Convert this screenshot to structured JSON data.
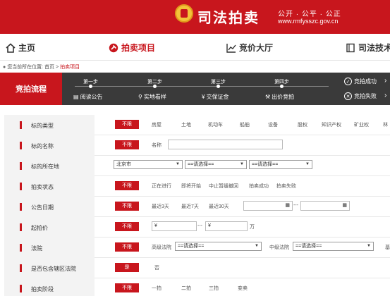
{
  "header": {
    "brand": "司法拍卖",
    "slogan": "公开 · 公平 · 公正",
    "domain": "www.rmfysszc.gov.cn"
  },
  "nav": {
    "items": [
      {
        "label": "主页",
        "icon": "home-icon"
      },
      {
        "label": "拍卖项目",
        "icon": "gavel-icon"
      },
      {
        "label": "竞价大厅",
        "icon": "chart-icon"
      },
      {
        "label": "司法技术",
        "icon": "book-icon"
      }
    ]
  },
  "breadcrumb": {
    "prefix": "您当前所在位置:",
    "home": "首页",
    "sep": ">",
    "current": "拍卖项目"
  },
  "flow": {
    "title": "竞拍流程",
    "steps": [
      {
        "num": "第一步",
        "label": "阅读公告"
      },
      {
        "num": "第二步",
        "label": "实地看样"
      },
      {
        "num": "第三步",
        "label": "交保证金"
      },
      {
        "num": "第四步",
        "label": "出价竞拍"
      }
    ],
    "success": "竞拍成功",
    "fail": "竞拍失败"
  },
  "filters": {
    "unlimited": "不限",
    "type": {
      "label": "标的类型",
      "options": [
        "房屋",
        "土地",
        "机动车",
        "船舶",
        "设备",
        "股权",
        "知识产权",
        "矿业权",
        "林"
      ]
    },
    "name": {
      "label": "标的名称",
      "field_label": "名称",
      "value": ""
    },
    "location": {
      "label": "标的所在地",
      "city": "北京市",
      "district": "==请选择==",
      "area": "==请选择=="
    },
    "status": {
      "label": "拍卖状态",
      "options": [
        "正在进行",
        "即将开始",
        "中止暂缓撤回",
        "拍卖成功",
        "拍卖失败"
      ]
    },
    "date": {
      "label": "公告日期",
      "options": [
        "最近3天",
        "最近7天",
        "最近30天"
      ],
      "sep": "---"
    },
    "price": {
      "label": "起拍价",
      "currency": "¥",
      "sep": "---",
      "unit": "万"
    },
    "court": {
      "label": "法院",
      "high_label": "高级法院",
      "high_value": "==请选择==",
      "mid_label": "中级法院",
      "mid_value": "==请选择==",
      "basic_label": "基"
    },
    "bonded": {
      "label": "是否包含辖区法院",
      "yes": "是",
      "no": "否"
    },
    "stage": {
      "label": "拍卖阶段",
      "options": [
        "一拍",
        "二拍",
        "三拍",
        "变卖"
      ]
    }
  }
}
